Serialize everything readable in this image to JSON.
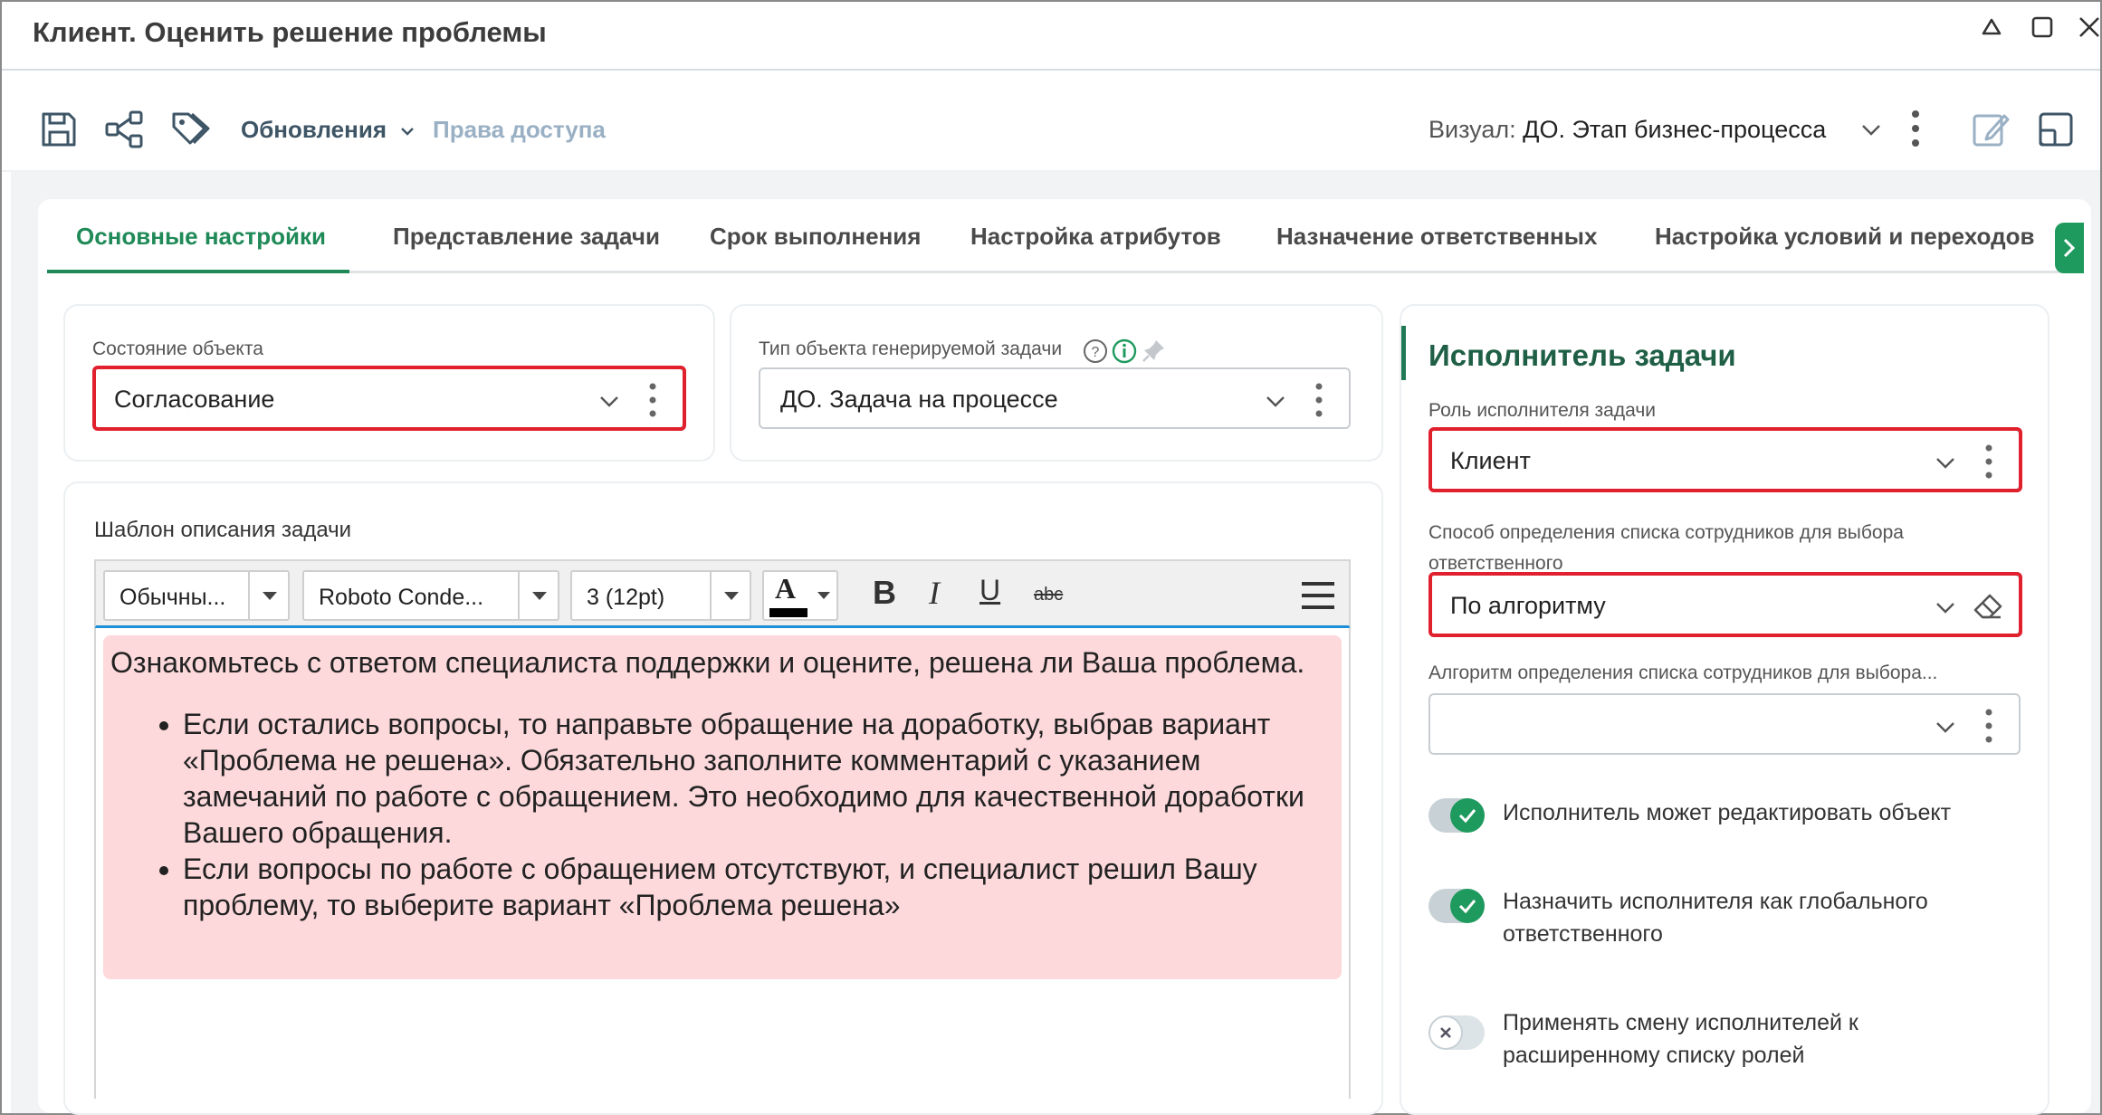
{
  "window": {
    "title": "Клиент. Оценить решение проблемы"
  },
  "toolbar": {
    "updates_label": "Обновления",
    "access_label": "Права доступа",
    "visual_label": "Визуал:",
    "visual_value": "ДО. Этап бизнес-процесса"
  },
  "tabs": [
    {
      "label": "Основные настройки",
      "active": true
    },
    {
      "label": "Представление задачи",
      "active": false
    },
    {
      "label": "Срок выполнения",
      "active": false
    },
    {
      "label": "Настройка атрибутов",
      "active": false
    },
    {
      "label": "Назначение ответственных",
      "active": false
    },
    {
      "label": "Настройка условий и переходов",
      "active": false
    }
  ],
  "object_state": {
    "label": "Состояние объекта",
    "value": "Согласование"
  },
  "task_type": {
    "label": "Тип объекта генерируемой задачи",
    "value": "ДО. Задача на процессе"
  },
  "template": {
    "label": "Шаблон описания задачи",
    "style": "Обычны...",
    "font": "Roboto Conde...",
    "size": "3 (12pt)",
    "font_color_glyph": "A",
    "bold": "B",
    "italic": "I",
    "underline": "U",
    "strike": "abc",
    "intro": "Ознакомьтесь с ответом специалиста поддержки и оцените, решена ли Ваша проблема.",
    "bullets": [
      "Если остались вопросы, то направьте обращение на доработку, выбрав вариант «Проблема не решена». Обязательно заполните комментарий с указанием замечаний по работе с обращением. Это необходимо для качественной доработки Вашего обращения.",
      "Если вопросы по работе с обращением отсутствуют, и специалист решил Вашу проблему, то выберите вариант «Проблема решена»"
    ]
  },
  "executor": {
    "title": "Исполнитель задачи",
    "role_label": "Роль исполнителя задачи",
    "role_value": "Клиент",
    "method_label": "Способ определения списка сотрудников для выбора ответственного",
    "method_value": "По алгоритму",
    "algorithm_label": "Алгоритм определения списка сотрудников для выбора...",
    "algorithm_value": "",
    "toggles": [
      {
        "label": "Исполнитель может редактировать объект",
        "on": true
      },
      {
        "label": "Назначить исполнителя как глобального ответственного",
        "on": true
      },
      {
        "label": "Применять смену исполнителей к расширенному списку ролей",
        "on": false
      }
    ]
  },
  "colors": {
    "accent": "#1f8a58",
    "highlight_border": "#e0202c",
    "note_background": "#fdd9dc"
  }
}
